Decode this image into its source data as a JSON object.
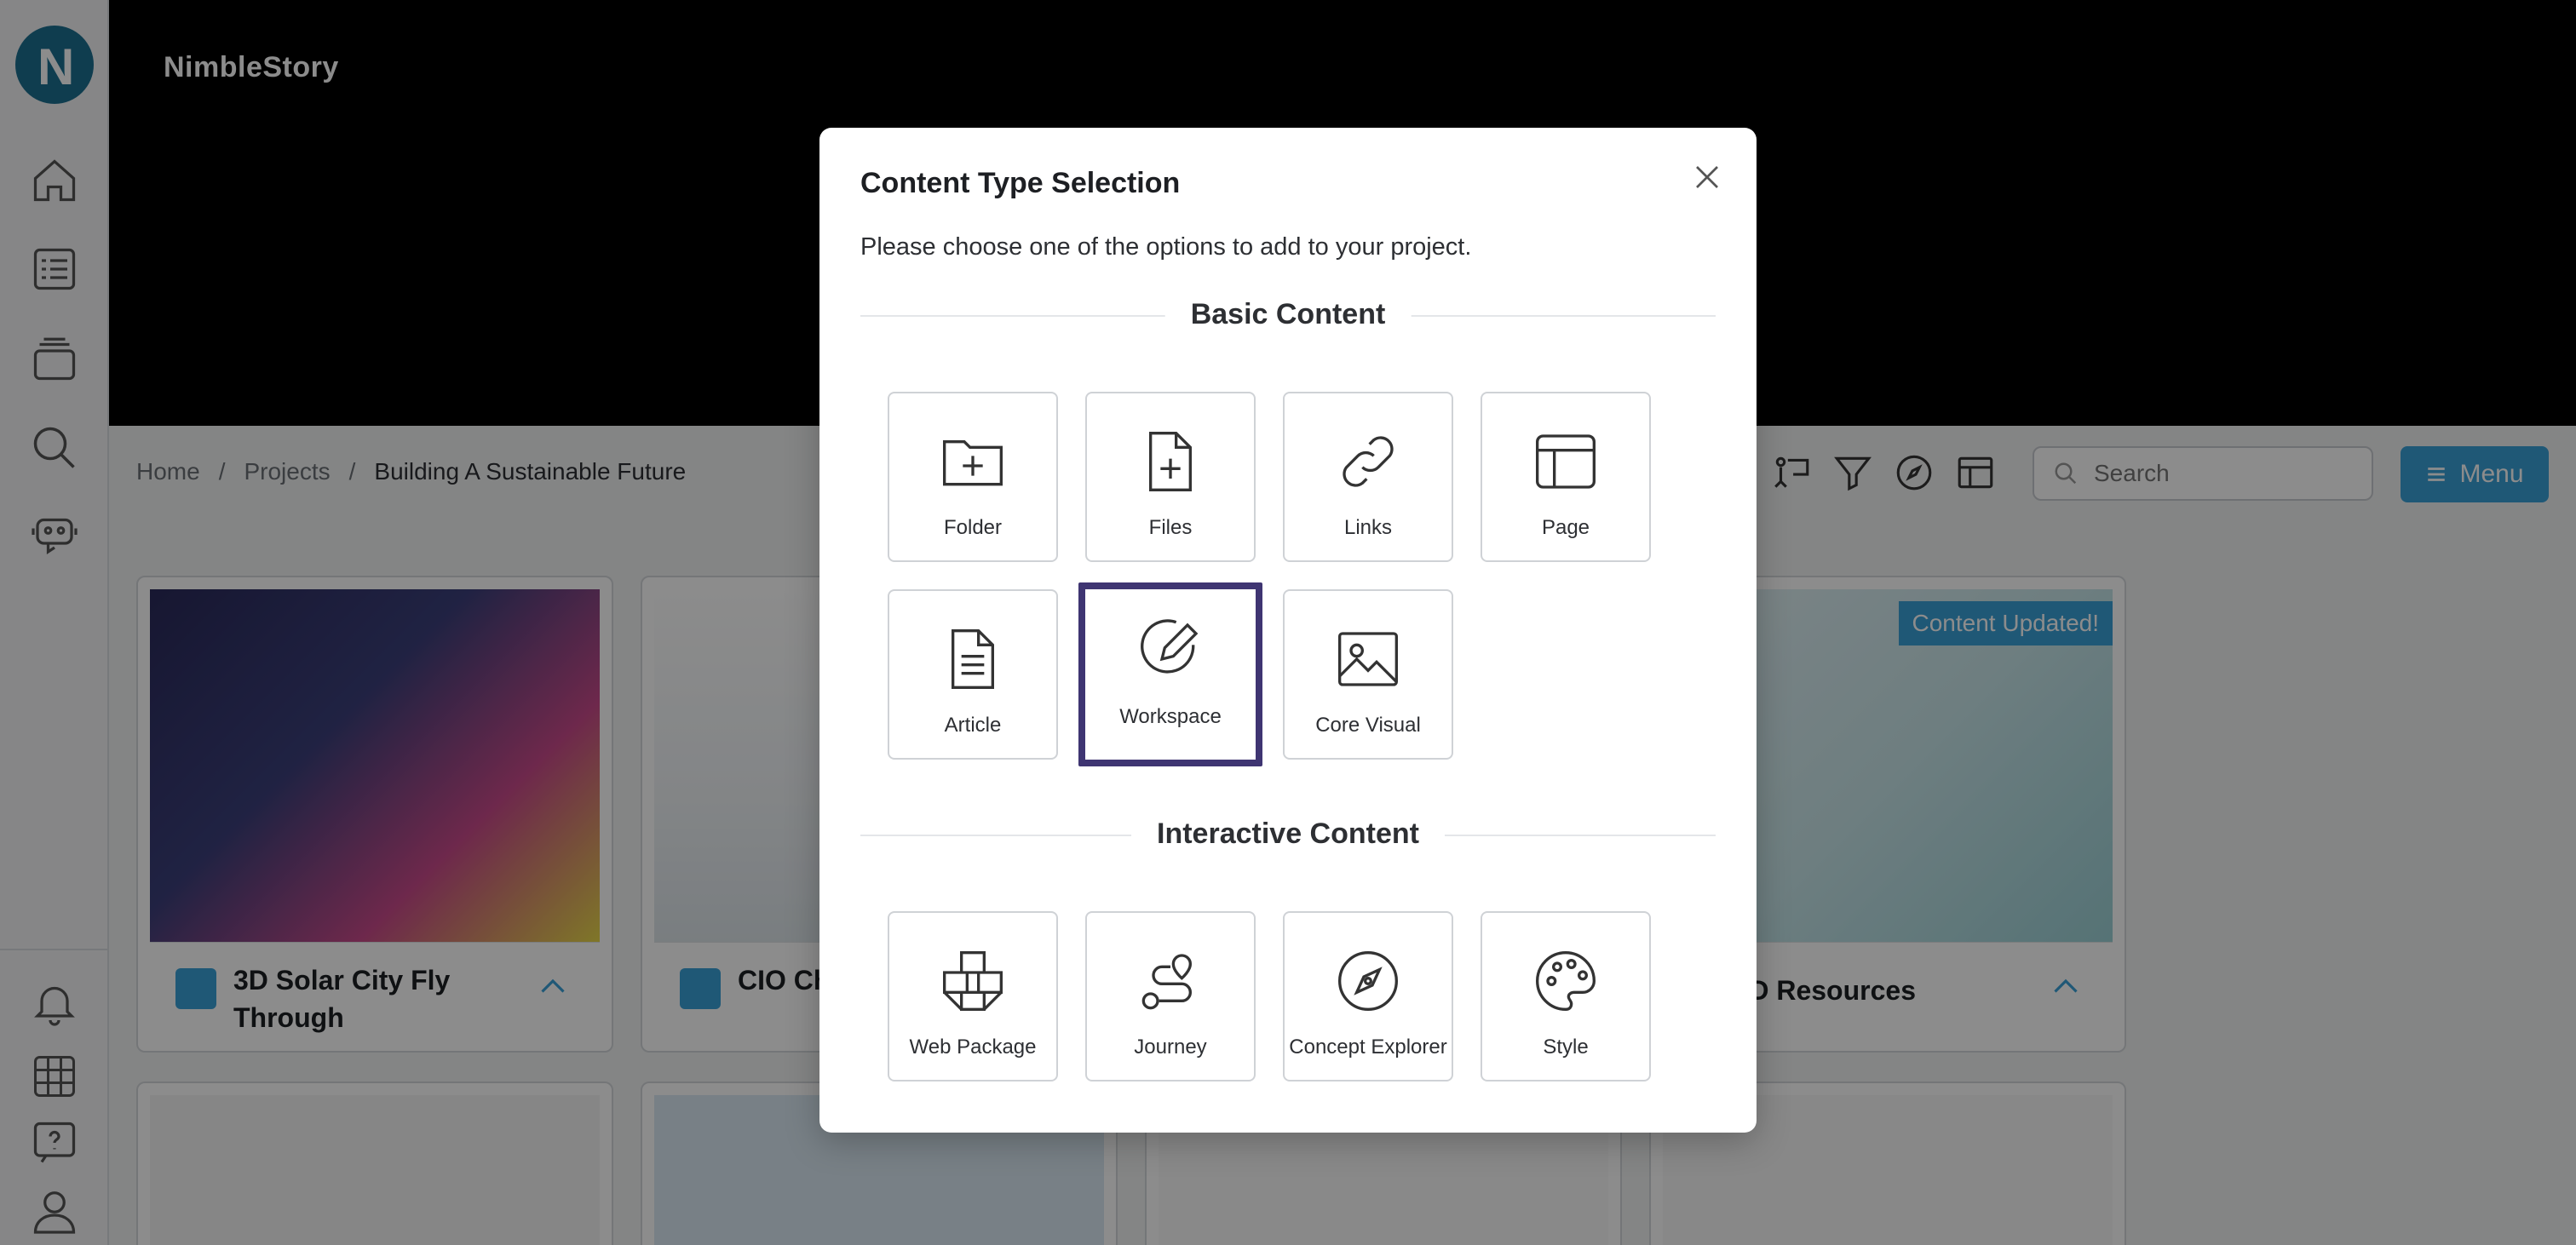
{
  "brand": {
    "logo_letter": "N",
    "name": "NimbleStory"
  },
  "breadcrumb": {
    "home": "Home",
    "sep": "/",
    "projects": "Projects",
    "current": "Building A Sustainable Future"
  },
  "search": {
    "placeholder": "Search"
  },
  "menu": {
    "label": "Menu"
  },
  "cards": [
    {
      "title": "3D Solar City Fly Through"
    },
    {
      "title": "CIO Ch… Manag…"
    },
    {
      "title": "SD Resources",
      "badge": "Content Updated!"
    }
  ],
  "modal": {
    "title": "Content Type Selection",
    "description": "Please choose one of the options to add to your project.",
    "basic_heading": "Basic Content",
    "interactive_heading": "Interactive Content",
    "basic_items": [
      {
        "label": "Folder",
        "icon": "folder-plus-icon"
      },
      {
        "label": "Files",
        "icon": "file-plus-icon"
      },
      {
        "label": "Links",
        "icon": "link-icon"
      },
      {
        "label": "Page",
        "icon": "page-layout-icon"
      },
      {
        "label": "Article",
        "icon": "article-icon"
      },
      {
        "label": "Workspace",
        "icon": "pencil-circle-icon",
        "selected": true
      },
      {
        "label": "Core Visual",
        "icon": "image-icon"
      }
    ],
    "interactive_items": [
      {
        "label": "Web Package",
        "icon": "cubes-icon"
      },
      {
        "label": "Journey",
        "icon": "route-icon"
      },
      {
        "label": "Concept Explorer",
        "icon": "compass-icon"
      },
      {
        "label": "Style",
        "icon": "palette-icon"
      }
    ]
  },
  "colors": {
    "accent": "#3aa0d8",
    "selected_border": "#3f3572",
    "logo": "#1d6f91"
  }
}
